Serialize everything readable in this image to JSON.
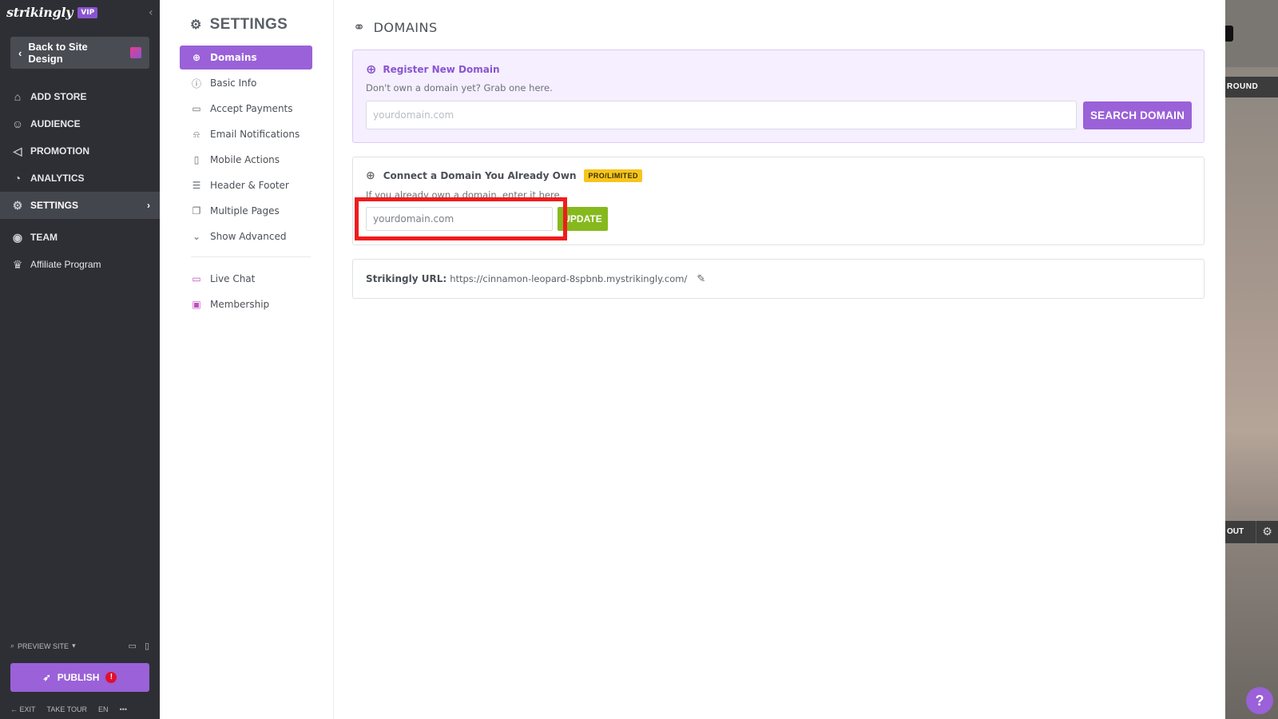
{
  "app": {
    "logo_text": "strikingly",
    "vip_badge": "VIP"
  },
  "left_sidebar": {
    "back_button": "Back to Site Design",
    "nav": [
      {
        "label": "ADD STORE",
        "icon": "store-icon"
      },
      {
        "label": "AUDIENCE",
        "icon": "audience-icon"
      },
      {
        "label": "PROMOTION",
        "icon": "megaphone-icon"
      },
      {
        "label": "ANALYTICS",
        "icon": "pie-chart-icon"
      },
      {
        "label": "SETTINGS",
        "icon": "gear-icon",
        "active": true
      },
      {
        "label": "TEAM",
        "icon": "team-icon"
      },
      {
        "label": "Affiliate Program",
        "icon": "trophy-icon"
      }
    ],
    "preview_site": "PREVIEW SITE",
    "publish": "PUBLISH",
    "publish_alert": "!",
    "footer": {
      "exit": "EXIT",
      "take_tour": "TAKE TOUR",
      "lang": "EN",
      "more": "•••"
    }
  },
  "settings_panel": {
    "title": "SETTINGS",
    "items": [
      {
        "label": "Domains",
        "icon": "globe-icon",
        "active": true
      },
      {
        "label": "Basic Info",
        "icon": "info-icon"
      },
      {
        "label": "Accept Payments",
        "icon": "card-icon"
      },
      {
        "label": "Email Notifications",
        "icon": "bell-icon"
      },
      {
        "label": "Mobile Actions",
        "icon": "mobile-icon"
      },
      {
        "label": "Header & Footer",
        "icon": "layout-icon"
      },
      {
        "label": "Multiple Pages",
        "icon": "pages-icon"
      },
      {
        "label": "Show Advanced",
        "icon": "chevron-down-icon"
      }
    ],
    "extras": [
      {
        "label": "Live Chat",
        "icon": "chat-icon"
      },
      {
        "label": "Membership",
        "icon": "membership-icon"
      }
    ]
  },
  "main": {
    "title": "DOMAINS",
    "register": {
      "title": "Register New Domain",
      "subtitle": "Don't own a domain yet? Grab one here.",
      "placeholder": "yourdomain.com",
      "button": "SEARCH DOMAIN"
    },
    "connect": {
      "title": "Connect a Domain You Already Own",
      "badge": "PRO/LIMITED",
      "subtitle": "If you already own a domain, enter it here.",
      "placeholder": "yourdomain.com",
      "button": "UPDATE"
    },
    "strikingly_url": {
      "label": "Strikingly URL:",
      "value": "https://cinnamon-leopard-8spbnb.mystrikingly.com/"
    }
  },
  "preview_strip": {
    "label_1": "ROUND",
    "label_2": "OUT"
  },
  "help": "?",
  "colors": {
    "accent": "#9a61d8",
    "update_green": "#86b91e",
    "highlight": "#f01c1c",
    "sidebar_bg": "#2e2f34"
  }
}
